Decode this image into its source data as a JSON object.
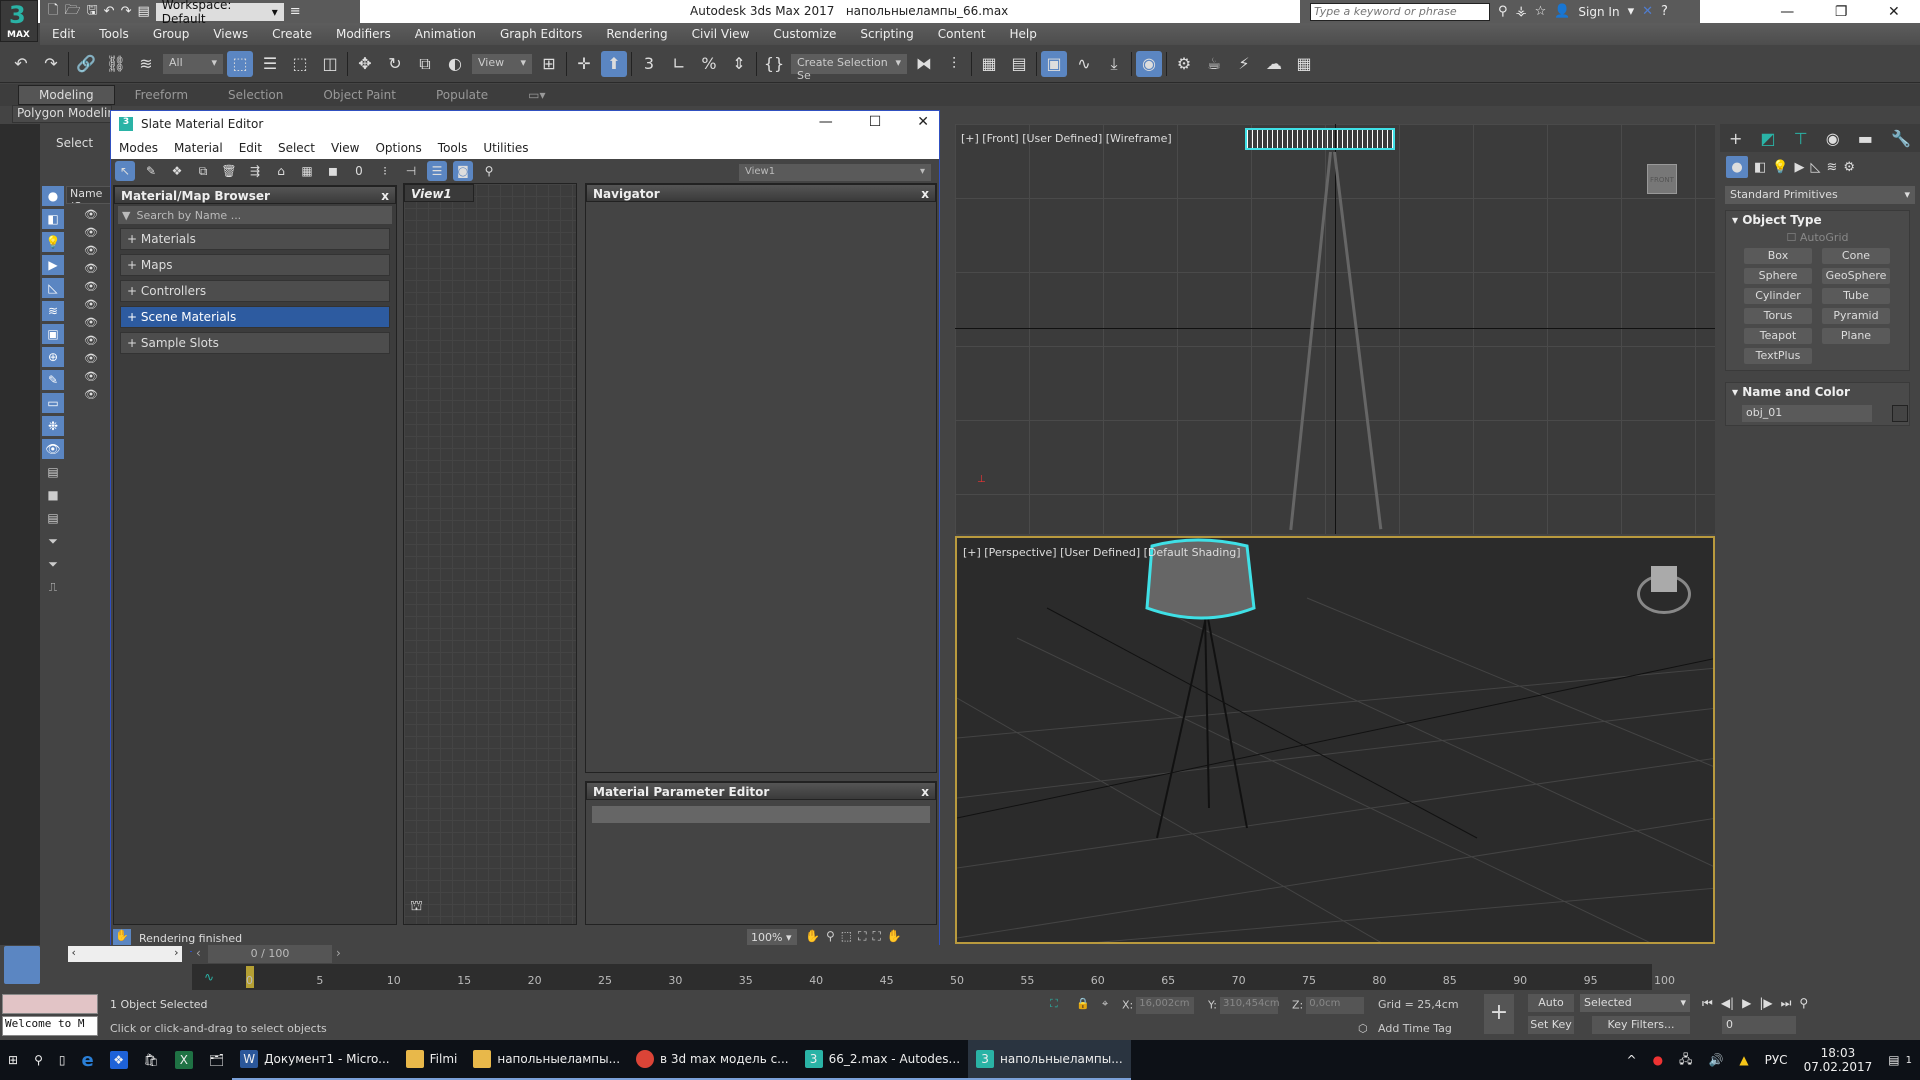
{
  "app": {
    "logo_number": "3",
    "logo_label": "MAX",
    "workspace": "Workspace: Default",
    "title": "Autodesk 3ds Max 2017",
    "filename": "напольныелампы_66.max",
    "search_placeholder": "Type a keyword or phrase",
    "sign_in": "Sign In"
  },
  "menu": [
    "Edit",
    "Tools",
    "Group",
    "Views",
    "Create",
    "Modifiers",
    "Animation",
    "Graph Editors",
    "Rendering",
    "Civil View",
    "Customize",
    "Scripting",
    "Content",
    "Help"
  ],
  "toolbar": {
    "selection_filter": "All",
    "ref_coord": "View",
    "named_selection": "Create Selection Se"
  },
  "ribbon": {
    "tabs": [
      "Modeling",
      "Freeform",
      "Selection",
      "Object Paint",
      "Populate"
    ],
    "active": "Modeling",
    "sub": "Polygon Modeling"
  },
  "scene_explorer": {
    "select_label": "Select",
    "name_header": "Name (S"
  },
  "slate": {
    "title": "Slate Material Editor",
    "menu": [
      "Modes",
      "Material",
      "Edit",
      "Select",
      "View",
      "Options",
      "Tools",
      "Utilities"
    ],
    "view_dropdown": "View1",
    "browser": {
      "title": "Material/Map Browser",
      "search_placeholder": "Search by Name ...",
      "categories": [
        "+ Materials",
        "+ Maps",
        "+ Controllers",
        "+ Scene Materials",
        "+ Sample Slots"
      ],
      "selected": "+ Scene Materials"
    },
    "view_tab": "View1",
    "navigator_title": "Navigator",
    "param_editor_title": "Material Parameter Editor",
    "status": "Rendering finished",
    "zoom": "100%"
  },
  "viewports": {
    "front_label": "[+] [Front] [User Defined] [Wireframe]",
    "persp_label": "[+] [Perspective] [User Defined] [Default Shading]",
    "viewcube_front": "FRONT"
  },
  "command_panel": {
    "category": "Standard Primitives",
    "object_type_title": "Object Type",
    "autogrid": "AutoGrid",
    "buttons": [
      "Box",
      "Cone",
      "Sphere",
      "GeoSphere",
      "Cylinder",
      "Tube",
      "Torus",
      "Pyramid",
      "Teapot",
      "Plane",
      "TextPlus"
    ],
    "name_color_title": "Name and Color",
    "object_name": "obj_01"
  },
  "timeline": {
    "frame_display": "0 / 100",
    "ticks": [
      "0",
      "5",
      "10",
      "15",
      "20",
      "25",
      "30",
      "35",
      "40",
      "45",
      "50",
      "55",
      "60",
      "65",
      "70",
      "75",
      "80",
      "85",
      "90",
      "95",
      "100"
    ]
  },
  "status": {
    "selection": "1 Object Selected",
    "prompt": "Click or click-and-drag to select objects",
    "listener": "Welcome to M",
    "x": "16,002cm",
    "y": "310,454cm",
    "z": "0,0cm",
    "grid": "Grid = 25,4cm",
    "add_time_tag": "Add Time Tag",
    "auto_key": "Auto Key",
    "set_key": "Set Key",
    "key_mode": "Selected",
    "key_filters": "Key Filters...",
    "current_frame": "0"
  },
  "taskbar": {
    "items": [
      "Документ1 - Micro...",
      "Filmi",
      "напольныелампы...",
      "в 3d max модель с...",
      "66_2.max - Autodes...",
      "напольныелампы..."
    ],
    "lang": "РУС",
    "time": "18:03",
    "date": "07.02.2017",
    "notifications": "1"
  }
}
